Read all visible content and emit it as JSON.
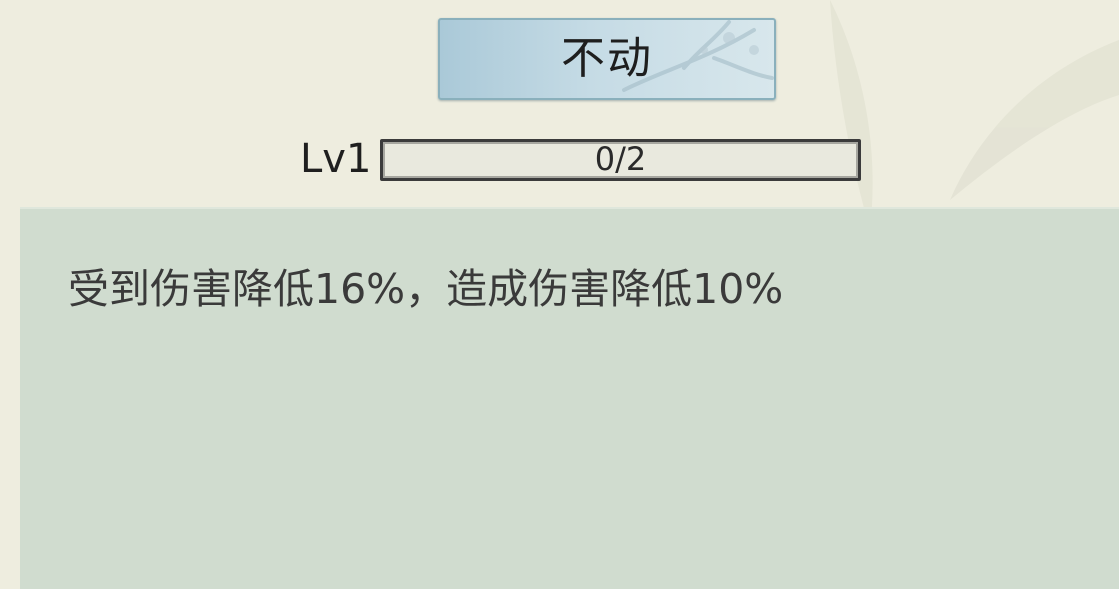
{
  "skill": {
    "name": "不动",
    "level_label": "Lv1",
    "progress_text": "0/2",
    "progress_fraction": 0,
    "description": "受到伤害降低16%，造成伤害降低10%"
  },
  "colors": {
    "background": "#eeeddf",
    "title_button": "#c5dbe5",
    "description_panel": "#d0dccf",
    "progress_border": "#3b3b3b"
  }
}
